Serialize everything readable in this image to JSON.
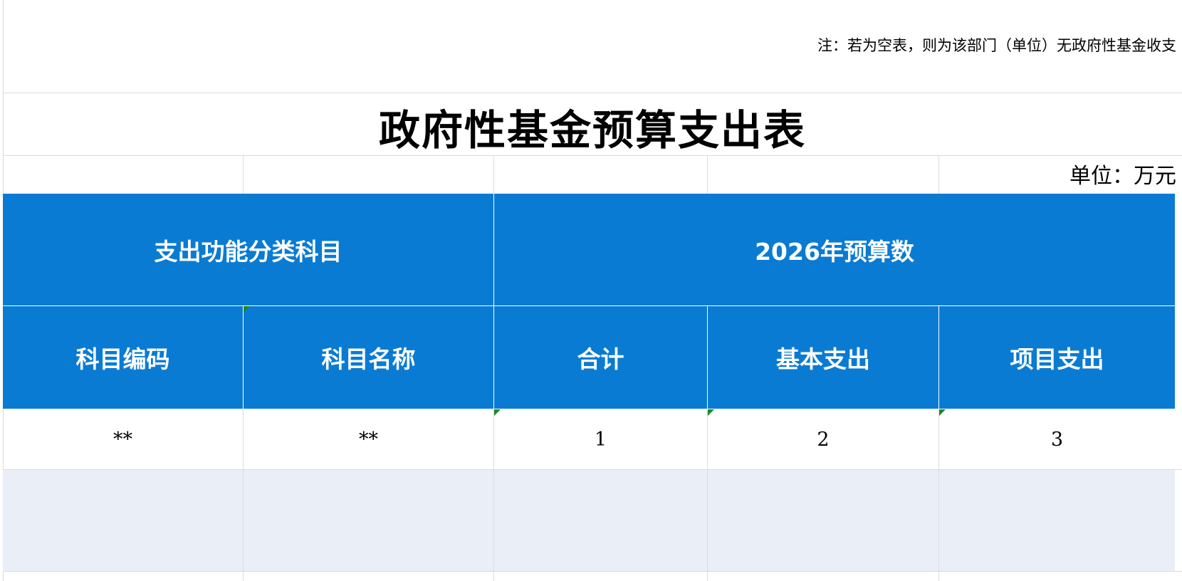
{
  "note": "注：若为空表，则为该部门（单位）无政府性基金收支",
  "title": "政府性基金预算支出表",
  "unit": "单位：万元",
  "header": {
    "group_left": "支出功能分类科目",
    "group_right": "2026年预算数",
    "columns": [
      "科目编码",
      "科目名称",
      "合计",
      "基本支出",
      "项目支出"
    ]
  },
  "index_row": [
    "**",
    "**",
    "1",
    "2",
    "3"
  ],
  "colors": {
    "header_bg": "#0a7bd3",
    "header_text": "#ffffff",
    "empty_row_bg": "#e9eef7",
    "indicator": "#1c8a1c"
  }
}
